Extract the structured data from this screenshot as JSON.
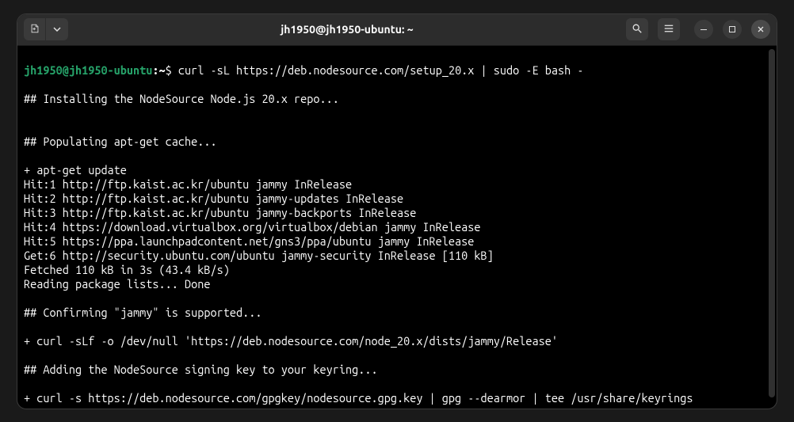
{
  "window": {
    "title": "jh1950@jh1950-ubuntu: ~"
  },
  "prompt": {
    "user_host": "jh1950@jh1950-ubuntu",
    "path": "~",
    "symbol": "$",
    "command": "curl -sL https://deb.nodesource.com/setup_20.x | sudo -E bash -"
  },
  "output": {
    "lines": [
      "",
      "## Installing the NodeSource Node.js 20.x repo...",
      "",
      "",
      "## Populating apt-get cache...",
      "",
      "+ apt-get update",
      "Hit:1 http://ftp.kaist.ac.kr/ubuntu jammy InRelease",
      "Hit:2 http://ftp.kaist.ac.kr/ubuntu jammy-updates InRelease",
      "Hit:3 http://ftp.kaist.ac.kr/ubuntu jammy-backports InRelease",
      "Hit:4 https://download.virtualbox.org/virtualbox/debian jammy InRelease",
      "Hit:5 https://ppa.launchpadcontent.net/gns3/ppa/ubuntu jammy InRelease",
      "Get:6 http://security.ubuntu.com/ubuntu jammy-security InRelease [110 kB]",
      "Fetched 110 kB in 3s (43.4 kB/s)",
      "Reading package lists... Done",
      "",
      "## Confirming \"jammy\" is supported...",
      "",
      "+ curl -sLf -o /dev/null 'https://deb.nodesource.com/node_20.x/dists/jammy/Release'",
      "",
      "## Adding the NodeSource signing key to your keyring...",
      "",
      "+ curl -s https://deb.nodesource.com/gpgkey/nodesource.gpg.key | gpg --dearmor | tee /usr/share/keyrings"
    ]
  }
}
